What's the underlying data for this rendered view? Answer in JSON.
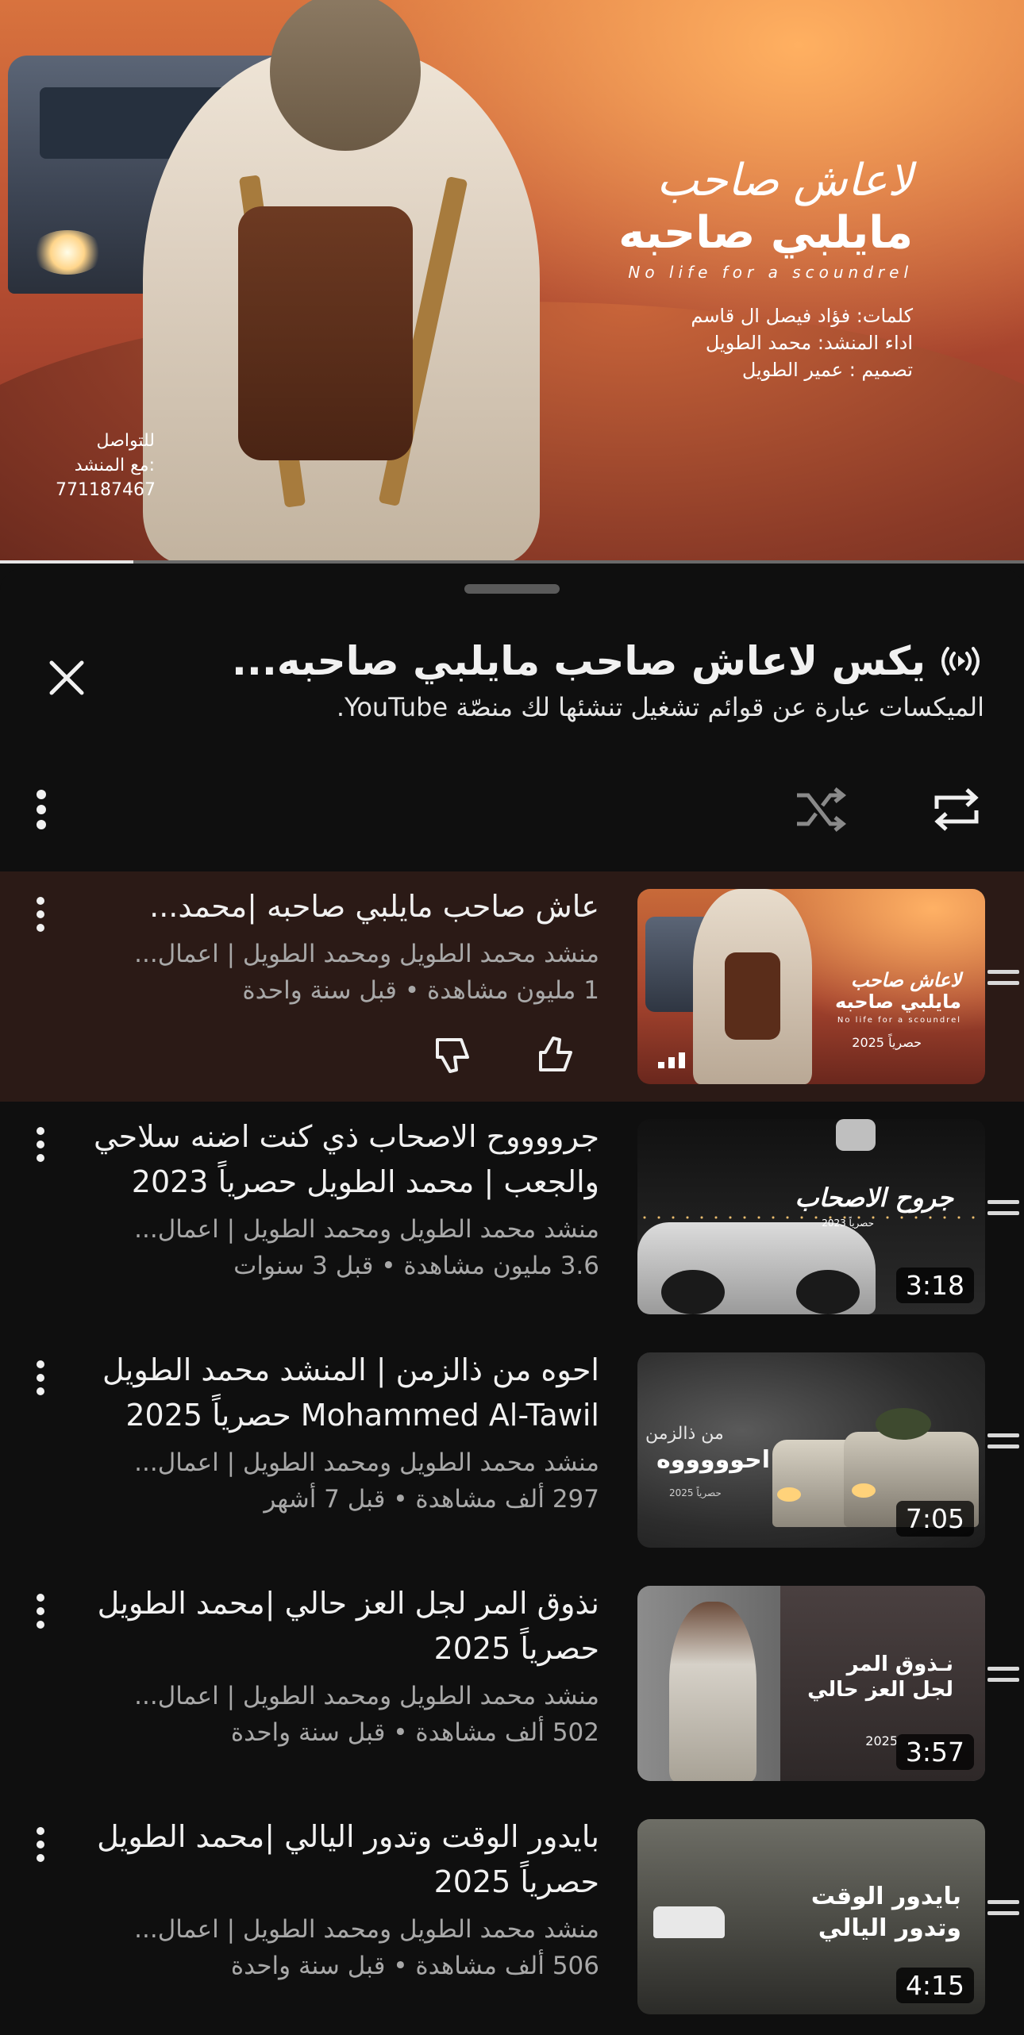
{
  "video": {
    "art_calligraphy": "لاعاش صاحب",
    "art_title": "مايلبي صاحبه",
    "art_english": "No life for a scoundrel",
    "credit_lyrics": "كلمات: فؤاد فيصل ال قاسم",
    "credit_singer": "اداء المنشد: محمد الطويل",
    "credit_design": "تصميم : عمير الطويل",
    "contact_line1": "للتواصل",
    "contact_line2": "مع المنشد:",
    "contact_phone": "771187467",
    "progress": 0.13
  },
  "sheet": {
    "title": "يكس لاعاش صاحب مايلبي صاحبه...",
    "subtitle": "الميكسات عبارة عن قوائم تشغيل تنشئها لك منصّة YouTube.",
    "icons": {
      "close": "close-icon",
      "radio": "radio-mix-icon",
      "more": "more-vert-icon",
      "shuffle": "shuffle-icon",
      "loop": "loop-icon"
    }
  },
  "queue": [
    {
      "title": "عاش صاحب مايلبي صاحبه |محمد...",
      "channel": "منشد محمد الطويل ومحمد الطويل | اعمال...",
      "meta": "1 مليون مشاهدة • قبل سنة واحدة",
      "thumb_line1": "لاعاش صاحب",
      "thumb_line2": "مايلبي صاحبه",
      "thumb_line3": "No life for a scoundrel",
      "thumb_line4": "حصرياً 2025",
      "current": true
    },
    {
      "title": "جرووووح الاصحاب ذي كنت اضنه سلاحي والجعب | محمد الطويل حصرياً 2023",
      "channel": "منشد محمد الطويل ومحمد الطويل | اعمال...",
      "meta": "3.6 مليون مشاهدة • قبل 3 سنوات",
      "duration": "3:18",
      "thumb_line1": "جروح الاصحاب",
      "thumb_line2": "حصرياً 2023"
    },
    {
      "title": "احوه من ذالزمن | المنشد محمد الطويل Mohammed Al-Tawil حصرياً 2025",
      "channel": "منشد محمد الطويل ومحمد الطويل | اعمال...",
      "meta": "297 ألف مشاهدة • قبل 7 أشهر",
      "duration": "7:05",
      "thumb_line1": "من ذالزمن",
      "thumb_line2": "احوووووه",
      "thumb_line3": "حصرياً 2025"
    },
    {
      "title": "نذوق المر لجل العز حالي |محمد الطويل حصرياً 2025",
      "channel": "منشد محمد الطويل ومحمد الطويل | اعمال...",
      "meta": "502 ألف مشاهدة • قبل سنة واحدة",
      "duration": "3:57",
      "thumb_line1": "نـذوق المر",
      "thumb_line2": "لجل العز حالي",
      "thumb_line3": "2025"
    },
    {
      "title": "بايدور الوقت وتدور اليالي |محمد الطويل حصرياً 2025",
      "channel": "منشد محمد الطويل ومحمد الطويل | اعمال...",
      "meta": "506 ألف مشاهدة • قبل سنة واحدة",
      "duration": "4:15",
      "thumb_line1": "بايدور الوقت",
      "thumb_line2": "وتدور اليالي"
    }
  ]
}
